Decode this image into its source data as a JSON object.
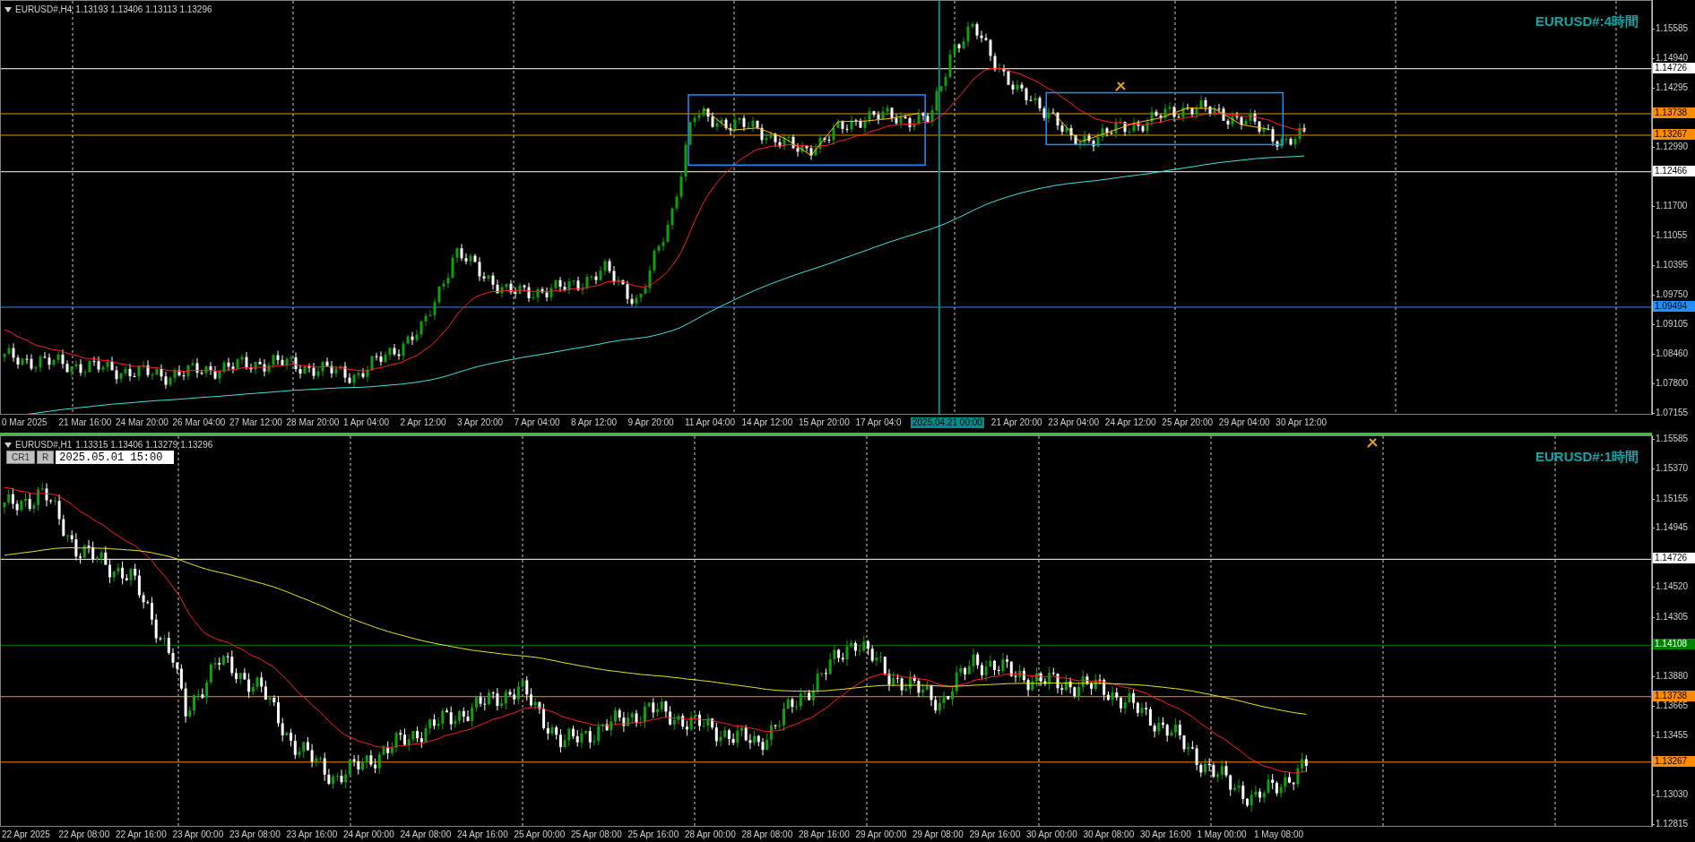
{
  "panes": [
    {
      "symbol": "EURUSD#,H4",
      "ohlc": "1.13193 1.13406 1.13113 1.13296",
      "title": "EURUSD#:4時間",
      "kind": "h4",
      "price_ticks": [
        "1.15585",
        "1.14940",
        "1.14295",
        "1.12990",
        "1.11700",
        "1.11055",
        "1.10395",
        "1.09750",
        "1.09105",
        "1.08460",
        "1.07800",
        "1.07155"
      ],
      "price_lines": [
        {
          "label": "1.14726",
          "color": "#ffffff"
        },
        {
          "label": "1.13738",
          "color": "#ff8c00"
        },
        {
          "label": "1.13267",
          "color": "#ff8c00"
        },
        {
          "label": "1.12466",
          "color": "#ffffff"
        },
        {
          "label": "1.09494",
          "color": "#1e90ff"
        }
      ],
      "time_labels": [
        {
          "text": "0 Mar 2025",
          "highlighted": false
        },
        {
          "text": "21 Mar 16:00",
          "highlighted": false
        },
        {
          "text": "24 Mar 20:00",
          "highlighted": false
        },
        {
          "text": "26 Mar 04:00",
          "highlighted": false
        },
        {
          "text": "27 Mar 12:00",
          "highlighted": false
        },
        {
          "text": "28 Mar 20:00",
          "highlighted": false
        },
        {
          "text": "1 Apr 04:00",
          "highlighted": false
        },
        {
          "text": "2 Apr 12:00",
          "highlighted": false
        },
        {
          "text": "3 Apr 20:00",
          "highlighted": false
        },
        {
          "text": "7 Apr 04:00",
          "highlighted": false
        },
        {
          "text": "8 Apr 12:00",
          "highlighted": false
        },
        {
          "text": "9 Apr 20:00",
          "highlighted": false
        },
        {
          "text": "11 Apr 04:00",
          "highlighted": false
        },
        {
          "text": "14 Apr 12:00",
          "highlighted": false
        },
        {
          "text": "15 Apr 20:00",
          "highlighted": false
        },
        {
          "text": "17 Apr 04:0",
          "highlighted": false
        },
        {
          "text": "2025.04.21 00:00",
          "highlighted": true
        },
        {
          "text": "21 Apr 20:00",
          "highlighted": false
        },
        {
          "text": "23 Apr 04:00",
          "highlighted": false
        },
        {
          "text": "24 Apr 12:00",
          "highlighted": false
        },
        {
          "text": "25 Apr 20:00",
          "highlighted": false
        },
        {
          "text": "29 Apr 04:00",
          "highlighted": false
        },
        {
          "text": "30 Apr 12:00",
          "highlighted": false
        }
      ]
    },
    {
      "symbol": "EURUSD#,H1",
      "ohlc": "1.13315 1.13406 1.13279 1.13296",
      "title": "EURUSD#:1時間",
      "kind": "h1",
      "active": true,
      "toolbar": {
        "buttons": [
          "CR1",
          "R"
        ],
        "date": "2025.05.01 15:00"
      },
      "price_ticks": [
        "1.15585",
        "1.15370",
        "1.15155",
        "1.14945",
        "1.14520",
        "1.14305",
        "1.13880",
        "1.13665",
        "1.13455",
        "1.13030",
        "1.12815"
      ],
      "price_lines": [
        {
          "label": "1.14726",
          "color": "#ffffff"
        },
        {
          "label": "1.14108",
          "color": "#008000"
        },
        {
          "label": "1.13738",
          "color": "#ff8c00"
        },
        {
          "label": "1.13267",
          "color": "#ff8c00"
        }
      ],
      "time_labels": [
        {
          "text": "22 Apr 2025",
          "highlighted": false
        },
        {
          "text": "22 Apr 08:00",
          "highlighted": false
        },
        {
          "text": "22 Apr 16:00",
          "highlighted": false
        },
        {
          "text": "23 Apr 00:00",
          "highlighted": false
        },
        {
          "text": "23 Apr 08:00",
          "highlighted": false
        },
        {
          "text": "23 Apr 16:00",
          "highlighted": false
        },
        {
          "text": "24 Apr 00:00",
          "highlighted": false
        },
        {
          "text": "24 Apr 08:00",
          "highlighted": false
        },
        {
          "text": "24 Apr 16:00",
          "highlighted": false
        },
        {
          "text": "25 Apr 00:00",
          "highlighted": false
        },
        {
          "text": "25 Apr 08:00",
          "highlighted": false
        },
        {
          "text": "25 Apr 16:00",
          "highlighted": false
        },
        {
          "text": "28 Apr 00:00",
          "highlighted": false
        },
        {
          "text": "28 Apr 08:00",
          "highlighted": false
        },
        {
          "text": "28 Apr 16:00",
          "highlighted": false
        },
        {
          "text": "29 Apr 00:00",
          "highlighted": false
        },
        {
          "text": "29 Apr 08:00",
          "highlighted": false
        },
        {
          "text": "29 Apr 16:00",
          "highlighted": false
        },
        {
          "text": "30 Apr 00:00",
          "highlighted": false
        },
        {
          "text": "30 Apr 08:00",
          "highlighted": false
        },
        {
          "text": "30 Apr 16:00",
          "highlighted": false
        },
        {
          "text": "1 May 00:00",
          "highlighted": false
        },
        {
          "text": "1 May 08:00",
          "highlighted": false
        }
      ]
    }
  ]
}
